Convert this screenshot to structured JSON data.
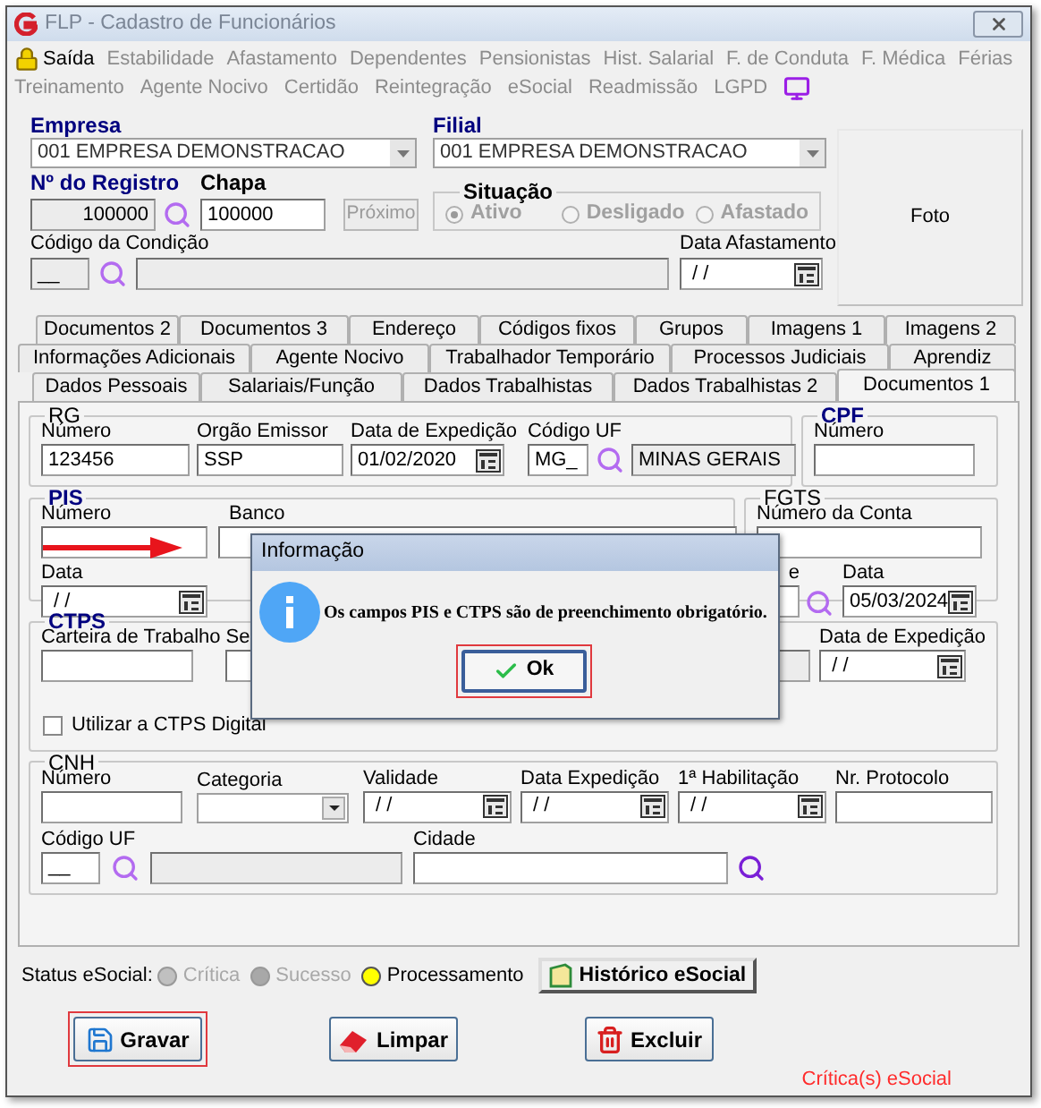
{
  "window": {
    "title": "FLP - Cadastro de Funcionários"
  },
  "menu_rows": [
    [
      {
        "label": "Saída",
        "enabled": true
      },
      {
        "label": "Estabilidade",
        "enabled": false
      },
      {
        "label": "Afastamento",
        "enabled": false
      },
      {
        "label": "Dependentes",
        "enabled": false
      },
      {
        "label": "Pensionistas",
        "enabled": false
      },
      {
        "label": "Hist. Salarial",
        "enabled": false
      },
      {
        "label": "F. de Conduta",
        "enabled": false
      },
      {
        "label": "F. Médica",
        "enabled": false
      },
      {
        "label": "Férias",
        "enabled": false
      }
    ],
    [
      {
        "label": "Treinamento",
        "enabled": false
      },
      {
        "label": "Agente Nocivo",
        "enabled": false
      },
      {
        "label": "Certidão",
        "enabled": false
      },
      {
        "label": "Reintegração",
        "enabled": false
      },
      {
        "label": "eSocial",
        "enabled": false
      },
      {
        "label": "Readmissão",
        "enabled": false
      },
      {
        "label": "LGPD",
        "enabled": false
      }
    ]
  ],
  "header": {
    "empresa": {
      "label": "Empresa",
      "value": "001 EMPRESA DEMONSTRACAO"
    },
    "filial": {
      "label": "Filial",
      "value": "001 EMPRESA DEMONSTRACAO"
    },
    "registro": {
      "label": "Nº do Registro",
      "value": "100000"
    },
    "chapa": {
      "label": "Chapa",
      "value": "100000"
    },
    "next_button": "Próximo",
    "situacao": {
      "label": "Situação",
      "options": [
        {
          "label": "Ativo",
          "selected": true
        },
        {
          "label": "Desligado",
          "selected": false
        },
        {
          "label": "Afastado",
          "selected": false
        }
      ]
    },
    "condicao": {
      "label": "Código da Condição",
      "value": "__"
    },
    "data_afastamento": {
      "label": "Data Afastamento",
      "value": " / /"
    },
    "photo": "Foto"
  },
  "tab_rows": [
    [
      {
        "label": "Documentos 2",
        "selected": false
      },
      {
        "label": "Documentos 3",
        "selected": false
      },
      {
        "label": "Endereço",
        "selected": false
      },
      {
        "label": "Códigos fixos",
        "selected": false
      },
      {
        "label": "Grupos",
        "selected": false
      },
      {
        "label": "Imagens 1",
        "selected": false
      },
      {
        "label": "Imagens 2",
        "selected": false
      }
    ],
    [
      {
        "label": "Informações Adicionais",
        "selected": false
      },
      {
        "label": "Agente Nocivo",
        "selected": false
      },
      {
        "label": "Trabalhador Temporário",
        "selected": false
      },
      {
        "label": "Processos Judiciais",
        "selected": false
      },
      {
        "label": "Aprendiz",
        "selected": false
      }
    ],
    [
      {
        "label": "Dados Pessoais",
        "selected": false
      },
      {
        "label": "Salariais/Função",
        "selected": false
      },
      {
        "label": "Dados Trabalhistas",
        "selected": false
      },
      {
        "label": "Dados Trabalhistas 2",
        "selected": false
      },
      {
        "label": "Documentos 1",
        "selected": true
      }
    ]
  ],
  "rg": {
    "title": "RG",
    "numero": {
      "label": "Número",
      "value": "123456"
    },
    "orgao": {
      "label": "Orgão Emissor",
      "value": "SSP"
    },
    "data": {
      "label": "Data de Expedição",
      "value": "01/02/2020"
    },
    "uf": {
      "label": "Código UF",
      "value": "MG_"
    },
    "uf_name": "MINAS GERAIS"
  },
  "cpf": {
    "title": "CPF",
    "numero": {
      "label": "Número"
    }
  },
  "pis": {
    "title": "PIS",
    "numero": {
      "label": "Número"
    },
    "banco": {
      "label": "Banco"
    },
    "data": {
      "label": "Data",
      "value": " / /"
    }
  },
  "fgts": {
    "title": "FGTS",
    "conta": {
      "label": "Número da Conta"
    },
    "cut_label": "e",
    "data": {
      "label": "Data",
      "value": "05/03/2024"
    }
  },
  "ctps": {
    "title": "CTPS",
    "carteira": {
      "label": "Carteira de Trabalho"
    },
    "cut_label": "Se",
    "data": {
      "label": "Data de Expedição",
      "value": " / /"
    },
    "digital": {
      "label": "Utilizar a CTPS Digital",
      "checked": false
    }
  },
  "cnh": {
    "title": "CNH",
    "numero": {
      "label": "Número"
    },
    "categoria": {
      "label": "Categoria"
    },
    "validade": {
      "label": "Validade",
      "value": " / /"
    },
    "expedicao": {
      "label": "Data Expedição",
      "value": " / /"
    },
    "habilitacao": {
      "label": "1ª Habilitação",
      "value": " / /"
    },
    "protocolo": {
      "label": "Nr. Protocolo"
    },
    "uf": {
      "label": "Código UF",
      "value": "__"
    },
    "cidade": {
      "label": "Cidade"
    }
  },
  "status": {
    "label": "Status eSocial:",
    "items": [
      {
        "label": "Crítica",
        "color": "#c0c0c0",
        "enabled": false
      },
      {
        "label": "Sucesso",
        "color": "#a8a8a8",
        "enabled": false
      },
      {
        "label": "Processamento",
        "color": "#ffff00",
        "enabled": true
      }
    ],
    "history_button": "Histórico eSocial"
  },
  "buttons": [
    {
      "kind": "save",
      "label": "Gravar",
      "highlighted": true
    },
    {
      "kind": "clear",
      "label": "Limpar",
      "highlighted": false
    },
    {
      "kind": "delete",
      "label": "Excluir",
      "highlighted": false
    }
  ],
  "criticas_link": "Crítica(s) eSocial",
  "dialog": {
    "title": "Informação",
    "message": "Os campos PIS e CTPS são de preenchimento obrigatório.",
    "ok_button": {
      "label": "Ok",
      "highlighted": true
    }
  }
}
